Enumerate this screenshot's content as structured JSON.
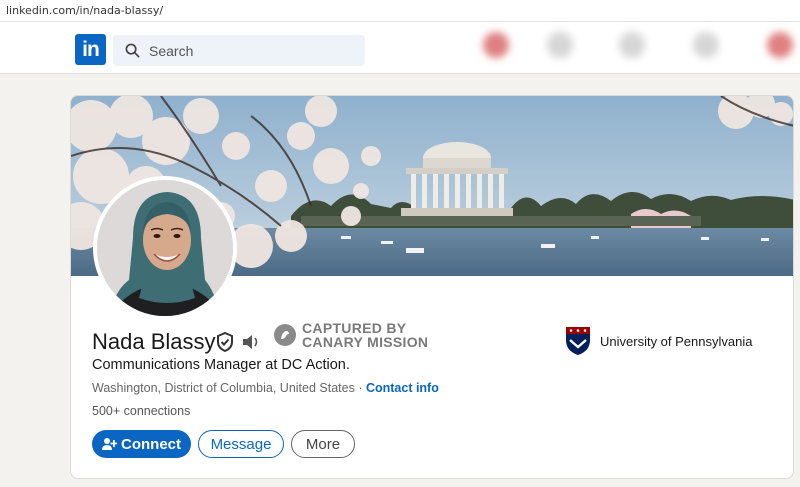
{
  "browser": {
    "url": "linkedin.com/in/nada-blassy/"
  },
  "nav": {
    "logo_text": "in",
    "search_placeholder": "Search"
  },
  "profile": {
    "name": "Nada Blassy",
    "captured_line1": "CAPTURED BY",
    "captured_line2": "CANARY MISSION",
    "headline": "Communications Manager at DC Action.",
    "location": "Washington, District of Columbia, United States",
    "location_separator": " · ",
    "contact_info": "Contact info",
    "connections": "500+ connections",
    "education": "University of Pennsylvania"
  },
  "actions": {
    "connect": "Connect",
    "message": "Message",
    "more": "More"
  },
  "colors": {
    "brand": "#0a66c2",
    "page_bg": "#f3f2ef",
    "penn_red": "#990000",
    "penn_blue": "#011f5b"
  },
  "icons": [
    "linkedin-logo-icon",
    "search-icon",
    "verified-shield-icon",
    "pronunciation-speaker-icon",
    "canary-mission-icon",
    "connect-plus-icon",
    "university-crest-icon"
  ]
}
